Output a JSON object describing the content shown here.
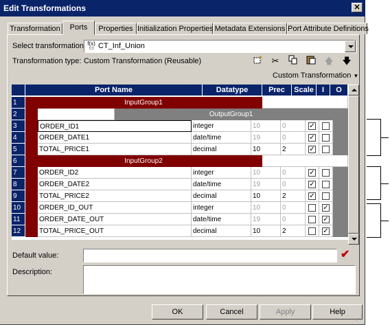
{
  "window": {
    "title": "Edit Transformations",
    "close_glyph": "✕"
  },
  "tabs": [
    "Transformation",
    "Ports",
    "Properties",
    "Initialization Properties",
    "Metadata Extensions",
    "Port Attribute Definitions"
  ],
  "form": {
    "select_label": "Select transformation:",
    "select_value": "CT_Inf_Union",
    "type_label": "Transformation type:",
    "type_value": "Custom Transformation (Reusable)",
    "custom_menu": "Custom Transformation",
    "default_label": "Default value:",
    "default_value": "",
    "description_label": "Description:",
    "description_value": ""
  },
  "toolbar_icons": [
    "new-port-icon",
    "cut-icon",
    "copy-icon",
    "paste-icon",
    "move-up-icon",
    "move-down-icon"
  ],
  "grid": {
    "columns": [
      "Port Name",
      "Datatype",
      "Prec",
      "Scale",
      "I",
      "O"
    ],
    "rows": [
      {
        "num": "1",
        "group": "InputGroup1",
        "kind": "input-group"
      },
      {
        "num": "2",
        "group": "OutputGroup1",
        "kind": "output-group"
      },
      {
        "num": "3",
        "name": "ORDER_ID1",
        "type": "integer",
        "prec": "10",
        "scale": "0",
        "prec_grey": true,
        "scale_grey": true,
        "i": true,
        "o": false
      },
      {
        "num": "4",
        "name": "ORDER_DATE1",
        "type": "date/time",
        "prec": "19",
        "scale": "0",
        "prec_grey": true,
        "scale_grey": true,
        "i": true,
        "o": false
      },
      {
        "num": "5",
        "name": "TOTAL_PRICE1",
        "type": "decimal",
        "prec": "10",
        "scale": "2",
        "prec_grey": false,
        "scale_grey": false,
        "i": true,
        "o": false
      },
      {
        "num": "6",
        "group": "InputGroup2",
        "kind": "input-group"
      },
      {
        "num": "7",
        "name": "ORDER_ID2",
        "type": "integer",
        "prec": "10",
        "scale": "0",
        "prec_grey": true,
        "scale_grey": true,
        "i": true,
        "o": false
      },
      {
        "num": "8",
        "name": "ORDER_DATE2",
        "type": "date/time",
        "prec": "19",
        "scale": "0",
        "prec_grey": true,
        "scale_grey": true,
        "i": true,
        "o": false
      },
      {
        "num": "9",
        "name": "TOTAL_PRICE2",
        "type": "decimal",
        "prec": "10",
        "scale": "2",
        "prec_grey": false,
        "scale_grey": false,
        "i": true,
        "o": false
      },
      {
        "num": "10",
        "name": "ORDER_ID_OUT",
        "type": "integer",
        "prec": "10",
        "scale": "0",
        "prec_grey": true,
        "scale_grey": true,
        "i": false,
        "o": true
      },
      {
        "num": "11",
        "name": "ORDER_DATE_OUT",
        "type": "date/time",
        "prec": "19",
        "scale": "0",
        "prec_grey": true,
        "scale_grey": true,
        "i": false,
        "o": true
      },
      {
        "num": "12",
        "name": "TOTAL_PRICE_OUT",
        "type": "decimal",
        "prec": "10",
        "scale": "2",
        "prec_grey": false,
        "scale_grey": false,
        "i": false,
        "o": true
      }
    ]
  },
  "buttons": {
    "ok": "OK",
    "cancel": "Cancel",
    "apply": "Apply",
    "help": "Help"
  },
  "colors": {
    "group_red": "#800000",
    "title_blue": "#0a246a",
    "panel_grey": "#d4d0c8",
    "check_red": "#c00000"
  }
}
